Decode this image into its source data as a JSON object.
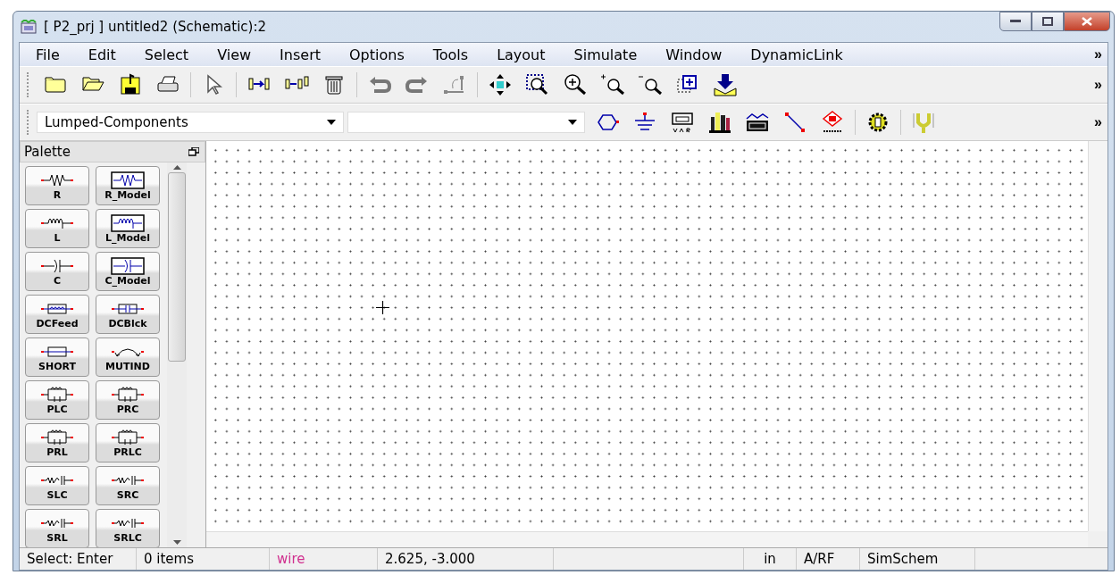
{
  "window": {
    "title": "[ P2_prj ] untitled2 (Schematic):2"
  },
  "menu": [
    "File",
    "Edit",
    "Select",
    "View",
    "Insert",
    "Options",
    "Tools",
    "Layout",
    "Simulate",
    "Window",
    "DynamicLink"
  ],
  "menu_overflow": "»",
  "toolbar": {
    "overflow": "»"
  },
  "component_toolbar": {
    "library_dropdown": {
      "value": "Lumped-Components"
    },
    "overflow": "»"
  },
  "palette": {
    "title": "Palette",
    "items": [
      {
        "label": "R",
        "kind": "resistor"
      },
      {
        "label": "R_Model",
        "kind": "resistor_model"
      },
      {
        "label": "L",
        "kind": "inductor"
      },
      {
        "label": "L_Model",
        "kind": "inductor_model"
      },
      {
        "label": "C",
        "kind": "capacitor"
      },
      {
        "label": "C_Model",
        "kind": "capacitor_model"
      },
      {
        "label": "DCFeed",
        "kind": "feed"
      },
      {
        "label": "DCBlck",
        "kind": "block"
      },
      {
        "label": "SHORT",
        "kind": "short"
      },
      {
        "label": "MUTIND",
        "kind": "mutual"
      },
      {
        "label": "PLC",
        "kind": "parallel"
      },
      {
        "label": "PRC",
        "kind": "parallel"
      },
      {
        "label": "PRL",
        "kind": "parallel"
      },
      {
        "label": "PRLC",
        "kind": "parallel"
      },
      {
        "label": "SLC",
        "kind": "series"
      },
      {
        "label": "SRC",
        "kind": "series"
      },
      {
        "label": "SRL",
        "kind": "series"
      },
      {
        "label": "SRLC",
        "kind": "series"
      }
    ]
  },
  "status_bar": [
    {
      "text": "Select: Enter",
      "kind": "plain"
    },
    {
      "text": "0 items",
      "kind": "plain"
    },
    {
      "text": "wire",
      "kind": "mode"
    },
    {
      "text": "2.625, -3.000",
      "kind": "plain"
    },
    {
      "text": "in",
      "kind": "plain"
    },
    {
      "text": "A/RF",
      "kind": "plain"
    },
    {
      "text": "SimSchem",
      "kind": "plain"
    }
  ]
}
